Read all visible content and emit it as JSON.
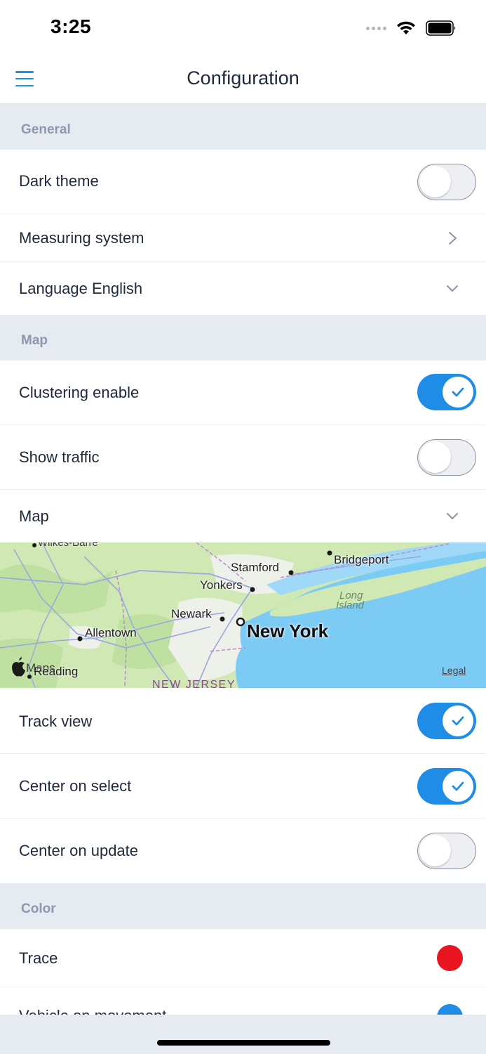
{
  "status_bar": {
    "time": "3:25"
  },
  "header": {
    "title": "Configuration",
    "menu_icon": "hamburger-menu-icon"
  },
  "sections": {
    "general": "General",
    "map": "Map",
    "color": "Color"
  },
  "general": {
    "dark_theme": {
      "label": "Dark theme",
      "enabled": false
    },
    "measuring_system": {
      "label": "Measuring system",
      "icon": "chevron-right-icon"
    },
    "language": {
      "label": "Language English",
      "icon": "chevron-down-icon"
    }
  },
  "map_settings": {
    "clustering": {
      "label": "Clustering enable",
      "enabled": true
    },
    "show_traffic": {
      "label": "Show traffic",
      "enabled": false
    },
    "map": {
      "label": "Map",
      "icon": "chevron-down-icon"
    },
    "track_view": {
      "label": "Track view",
      "enabled": true
    },
    "center_on_select": {
      "label": "Center on select",
      "enabled": true
    },
    "center_on_update": {
      "label": "Center on update",
      "enabled": false
    }
  },
  "map_preview": {
    "labels": {
      "top_city": "Wilkes-Barre",
      "stamford": "Stamford",
      "bridgeport": "Bridgeport",
      "yonkers": "Yonkers",
      "long_island_1": "Long",
      "long_island_2": "Island",
      "newark": "Newark",
      "new_york": "New York",
      "allentown": "Allentown",
      "reading": "Reading",
      "maps_logo": "Maps",
      "new_jersey": "NEW JERSEY",
      "legal": "Legal"
    },
    "colors": {
      "land": "#cfe8b4",
      "water": "#7ccbf5",
      "urban": "#eef0ea"
    }
  },
  "color_settings": {
    "trace": {
      "label": "Trace",
      "color": "#e8141f"
    },
    "vehicle_on_movement": {
      "label": "Vehicle on movement",
      "color": "#1f8ce6"
    }
  },
  "colors": {
    "accent": "#1f8ce6",
    "background": "#e6eaf1"
  }
}
